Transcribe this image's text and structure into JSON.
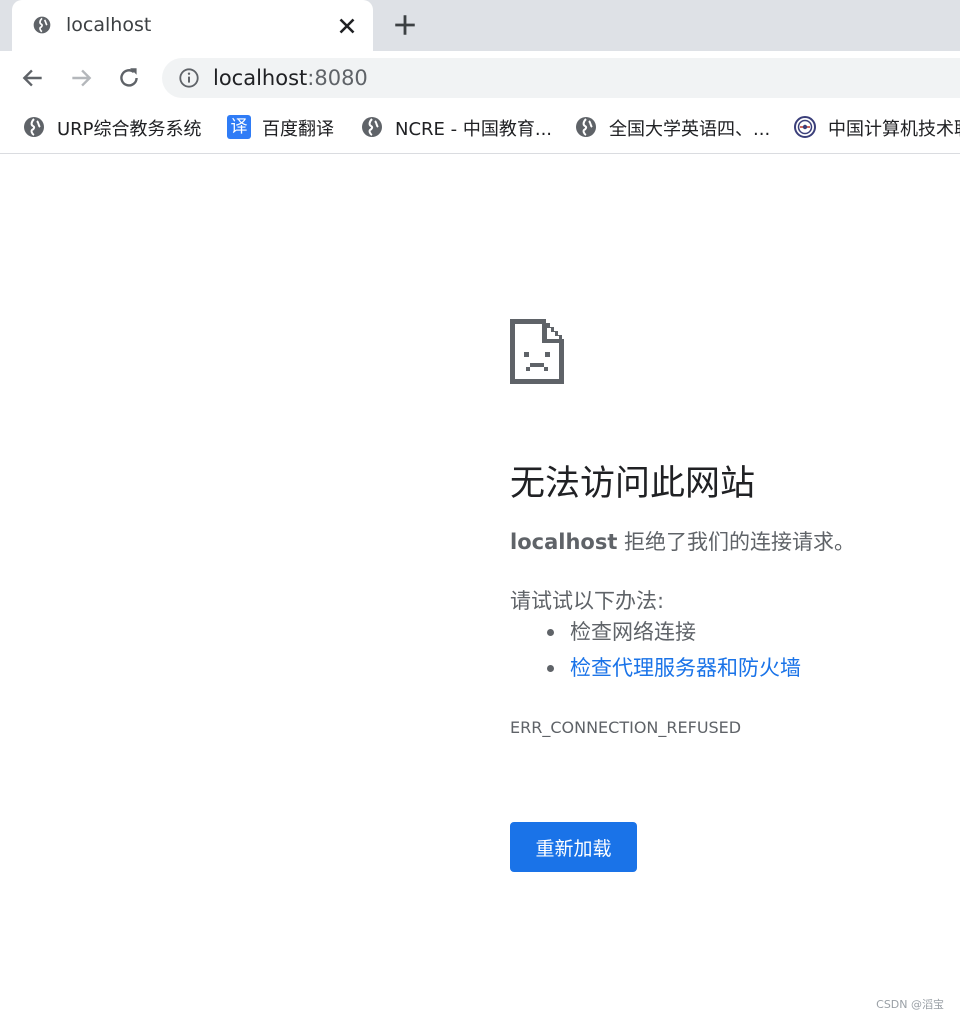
{
  "tab": {
    "title": "localhost",
    "favicon": "globe-icon",
    "close_icon": "close-icon"
  },
  "new_tab_icon": "plus-icon",
  "toolbar": {
    "back_icon": "back-arrow-icon",
    "forward_icon": "forward-arrow-icon",
    "reload_icon": "reload-icon",
    "info_icon": "info-icon",
    "url_host": "localhost",
    "url_port": ":8080"
  },
  "bookmarks": [
    {
      "label": "URP综合教务系统",
      "icon": "globe-icon"
    },
    {
      "label": "百度翻译",
      "icon": "baidu-translate-icon",
      "icon_text": "译"
    },
    {
      "label": "NCRE - 中国教育...",
      "icon": "globe-icon"
    },
    {
      "label": "全国大学英语四、...",
      "icon": "globe-icon"
    },
    {
      "label": "中国计算机技术职",
      "icon": "ccf-icon"
    }
  ],
  "error": {
    "icon": "sad-document-icon",
    "title": "无法访问此网站",
    "host": "localhost",
    "message": " 拒绝了我们的连接请求。",
    "try_label": "请试试以下办法:",
    "suggestions": [
      "检查网络连接",
      "检查代理服务器和防火墙"
    ],
    "code": "ERR_CONNECTION_REFUSED",
    "reload_label": "重新加载"
  },
  "watermark": "CSDN @滔宝",
  "colors": {
    "accent": "#1a73e8",
    "tabstrip": "#dee1e6",
    "text_secondary": "#5f6368"
  }
}
